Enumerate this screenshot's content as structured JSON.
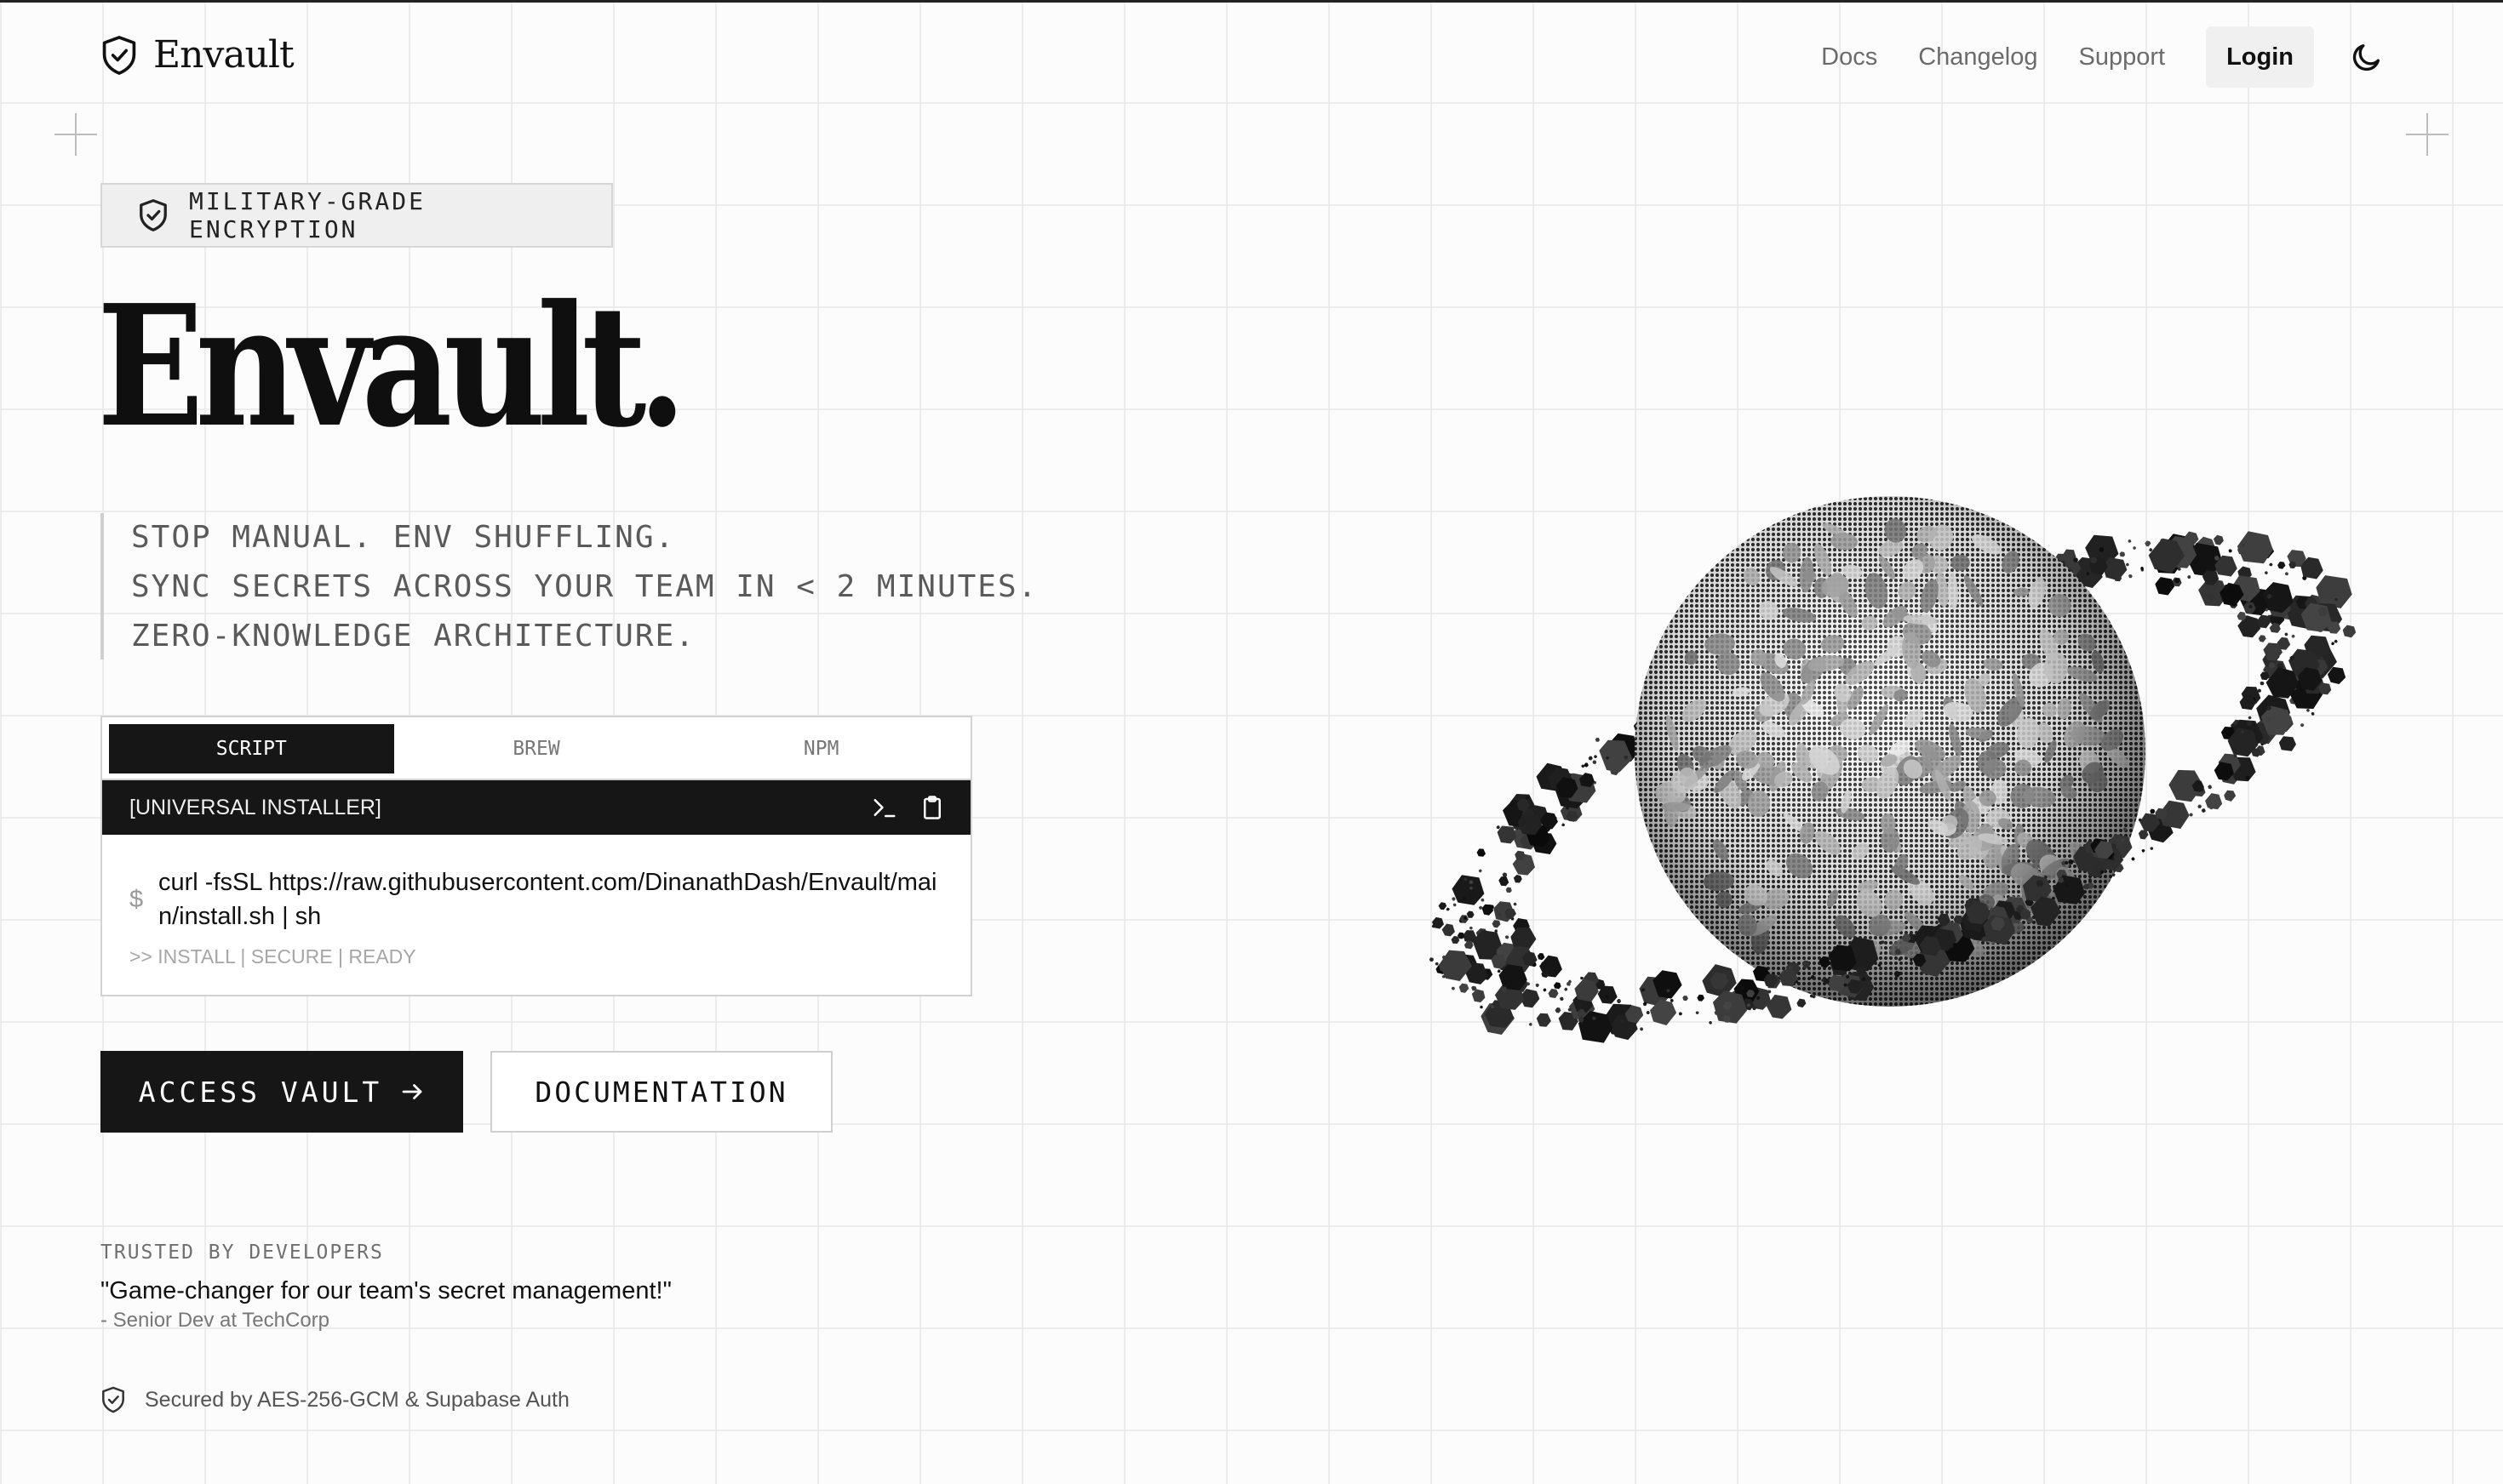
{
  "nav": {
    "brand": "Envault",
    "links": [
      "Docs",
      "Changelog",
      "Support"
    ],
    "login": "Login",
    "theme_icon": "moon-icon"
  },
  "hero": {
    "badge": "MILITARY-GRADE ENCRYPTION",
    "title": "Envault.",
    "tagline": [
      "STOP MANUAL. ENV SHUFFLING.",
      "SYNC SECRETS ACROSS YOUR TEAM IN < 2 MINUTES.",
      "ZERO-KNOWLEDGE ARCHITECTURE."
    ]
  },
  "installer": {
    "tabs": [
      "SCRIPT",
      "BREW",
      "NPM"
    ],
    "active_tab": "SCRIPT",
    "header": "[UNIVERSAL INSTALLER]",
    "prompt": "$",
    "command": "curl -fsSL https://raw.githubusercontent.com/DinanathDash/Envault/main/install.sh | sh",
    "hint": ">> INSTALL | SECURE | READY"
  },
  "actions": {
    "primary": "ACCESS VAULT",
    "secondary": "DOCUMENTATION"
  },
  "social_proof": {
    "label": "TRUSTED BY DEVELOPERS",
    "quote": "\"Game-changer for our team's secret management!\"",
    "author": "- Senior Dev at TechCorp"
  },
  "footer": {
    "secured": "Secured by AES-256-GCM & Supabase Auth"
  },
  "colors": {
    "background": "#fcfcfc",
    "ink": "#111111",
    "muted": "#6b6b6b",
    "dark_surface": "#161616"
  }
}
